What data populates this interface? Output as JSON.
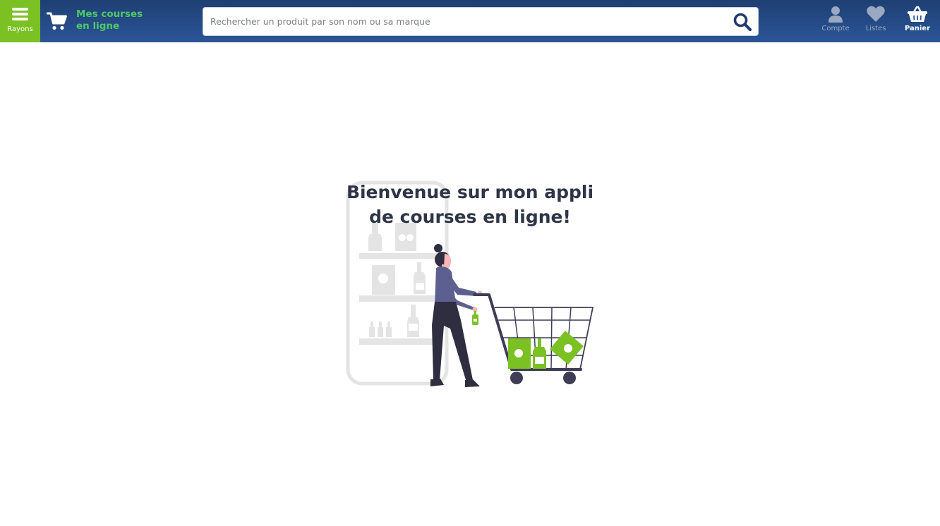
{
  "header": {
    "menu_label": "Rayons",
    "brand_line1": "Mes courses",
    "brand_line2": "en ligne",
    "search_placeholder": "Rechercher un produit par son nom ou sa marque",
    "nav": {
      "account_label": "Compte",
      "lists_label": "Listes",
      "cart_label": "Panier"
    }
  },
  "main": {
    "welcome_line1": "Bienvenue sur mon appli",
    "welcome_line2": "de courses en ligne!"
  },
  "colors": {
    "header_bg": "#2b5597",
    "accent_green": "#7cc123",
    "brand_text": "#4cc968",
    "text_dark": "#2e3547"
  }
}
